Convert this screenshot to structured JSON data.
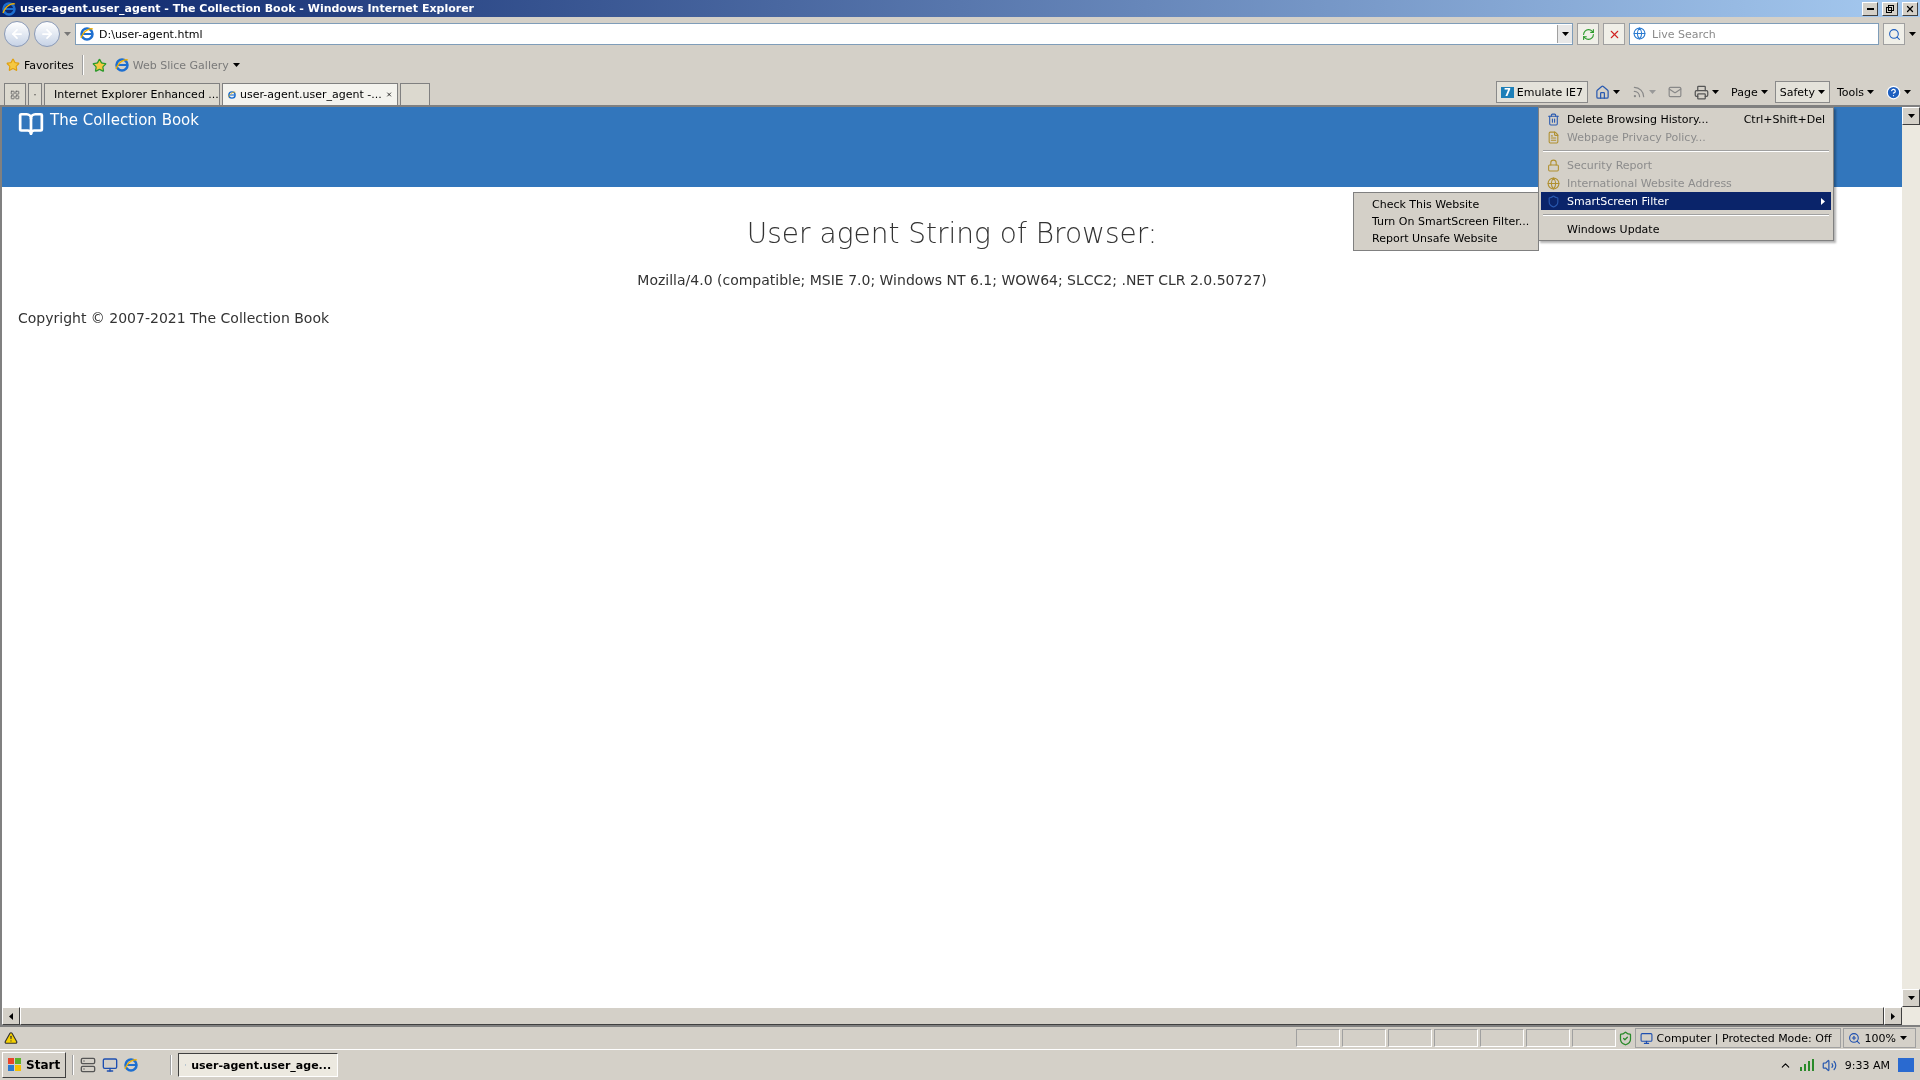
{
  "window": {
    "title": "user-agent.user_agent - The Collection Book - Windows Internet Explorer"
  },
  "address_bar": {
    "value": "D:\\user-agent.html"
  },
  "search": {
    "placeholder": "Live Search"
  },
  "favorites_bar": {
    "favorites": "Favorites",
    "items": [
      "Web Slice Gallery"
    ]
  },
  "tabs": [
    {
      "label": "Internet Explorer Enhanced ...",
      "selected": false
    },
    {
      "label": "user-agent.user_agent -...",
      "selected": true
    }
  ],
  "command_bar": {
    "emulate": {
      "badge": "7",
      "label": "Emulate IE7"
    },
    "menus": [
      {
        "label": "Page",
        "selected": false
      },
      {
        "label": "Safety",
        "selected": true
      },
      {
        "label": "Tools",
        "selected": false
      }
    ]
  },
  "page": {
    "site_name": "The Collection Book",
    "heading": "User agent String of Browser:",
    "user_agent": "Mozilla/4.0 (compatible; MSIE 7.0; Windows NT 6.1; WOW64; SLCC2; .NET CLR 2.0.50727)",
    "copyright": "Copyright © 2007-2021 The Collection Book"
  },
  "safety_menu": [
    {
      "kind": "item",
      "label": "Delete Browsing History...",
      "shortcut": "Ctrl+Shift+Del",
      "disabled": false,
      "selected": false
    },
    {
      "kind": "item",
      "label": "Webpage Privacy Policy...",
      "disabled": true,
      "selected": false
    },
    {
      "kind": "separator"
    },
    {
      "kind": "item",
      "label": "Security Report",
      "disabled": true,
      "selected": false
    },
    {
      "kind": "item",
      "label": "International Website Address",
      "disabled": true,
      "selected": false
    },
    {
      "kind": "submenu",
      "label": "SmartScreen Filter",
      "disabled": false,
      "selected": true
    },
    {
      "kind": "separator"
    },
    {
      "kind": "item",
      "label": "Windows Update",
      "disabled": false,
      "selected": false
    }
  ],
  "smartscreen_submenu": [
    "Check This Website",
    "Turn On SmartScreen Filter...",
    "Report Unsafe Website"
  ],
  "status_bar": {
    "zone": "Computer | Protected Mode: Off",
    "zoom": "100%"
  },
  "taskbar": {
    "start": "Start",
    "tasks": [
      "user-agent.user_age..."
    ],
    "clock": "9:33 AM"
  }
}
